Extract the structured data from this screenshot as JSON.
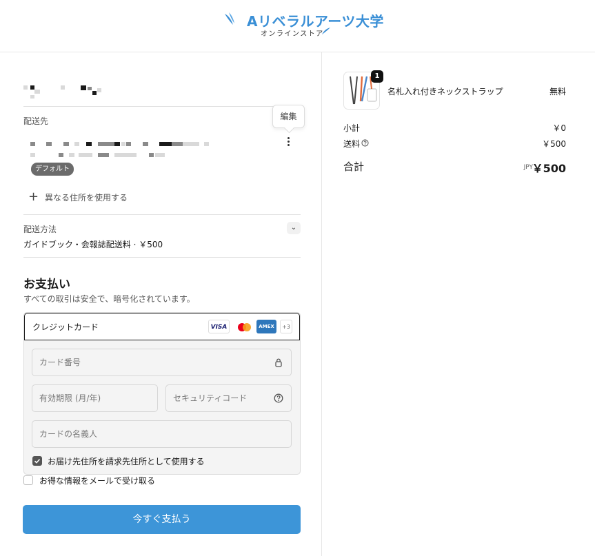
{
  "brand": {
    "logo_letter": "A",
    "name": "リベラルアーツ大学",
    "subtitle": "オンラインストア",
    "color": "#3a8fd6"
  },
  "contact": {
    "masked_email_icon": "redacted-pixel-block"
  },
  "shipping_address": {
    "section_label": "配送先",
    "masked_address_icon": "redacted-pixel-block",
    "default_badge": "デフォルト",
    "edit_tooltip": "編集",
    "menu_icon": "kebab-menu-icon",
    "add_address_icon": "plus-icon",
    "add_address_label": "異なる住所を使用する"
  },
  "shipping_method": {
    "label": "配送方法",
    "value": "ガイドブック・会報誌配送料 · ￥500",
    "toggle_icon": "chevron-down-icon"
  },
  "payment": {
    "title": "お支払い",
    "subtitle": "すべての取引は安全で、暗号化されています。",
    "method_label": "クレジットカード",
    "card_logos": {
      "visa": "VISA",
      "amex": "AMEX",
      "more": "+3"
    },
    "fields": {
      "card_number_placeholder": "カード番号",
      "expiry_placeholder": "有効期限 (月/年)",
      "security_code_placeholder": "セキュリティコード",
      "cardholder_placeholder": "カードの名義人"
    },
    "use_shipping_as_billing": {
      "label": "お届け先住所を請求先住所として使用する",
      "checked": true
    }
  },
  "marketing_optin": {
    "label": "お得な情報をメールで受け取る",
    "checked": false
  },
  "pay_button_label": "今すぐ支払う",
  "colors": {
    "accent": "#3d95d8",
    "text": "#1a1a1a",
    "muted": "#555555"
  },
  "order_summary": {
    "item": {
      "quantity": "1",
      "name": "名札入れ付きネックストラップ",
      "price": "無料",
      "thumbnail_icon": "lanyard-product-image"
    },
    "subtotal_label": "小計",
    "subtotal_value": "￥0",
    "shipping_label": "送料",
    "shipping_value": "￥500",
    "total_label": "合計",
    "total_currency": "JPY",
    "total_value": "￥500"
  }
}
